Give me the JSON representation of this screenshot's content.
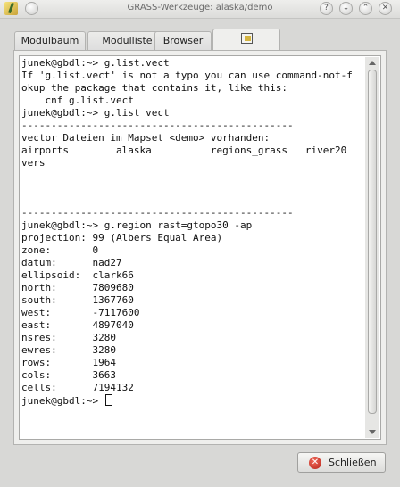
{
  "window": {
    "title": "GRASS-Werkzeuge: alaska/demo",
    "controls": {
      "help": "?",
      "minimize": "⌄",
      "maximize": "⌃",
      "close": "✕"
    }
  },
  "tabs": [
    {
      "label": "Modulbaum"
    },
    {
      "label": "Modulliste"
    },
    {
      "label": "Browser"
    },
    {
      "label": "",
      "icon": "command-console-icon",
      "active": true
    }
  ],
  "console": {
    "lines": [
      "junek@gbdl:~> g.list.vect",
      "If 'g.list.vect' is not a typo you can use command-not-f",
      "okup the package that contains it, like this:",
      "    cnf g.list.vect",
      "junek@gbdl:~> g.list vect",
      "----------------------------------------------",
      "vector Dateien im Mapset <demo> vorhanden:",
      "airports        alaska          regions_grass   river20",
      "vers",
      "",
      "",
      "",
      "----------------------------------------------",
      "junek@gbdl:~> g.region rast=gtopo30 -ap",
      "projection: 99 (Albers Equal Area)",
      "zone:       0",
      "datum:      nad27",
      "ellipsoid:  clark66",
      "north:      7809680",
      "south:      1367760",
      "west:       -7117600",
      "east:       4897040",
      "nsres:      3280",
      "ewres:      3280",
      "rows:       1964",
      "cols:       3663",
      "cells:      7194132"
    ],
    "prompt": "junek@gbdl:~> "
  },
  "close_button": {
    "label": "Schließen",
    "icon": "close-icon"
  }
}
